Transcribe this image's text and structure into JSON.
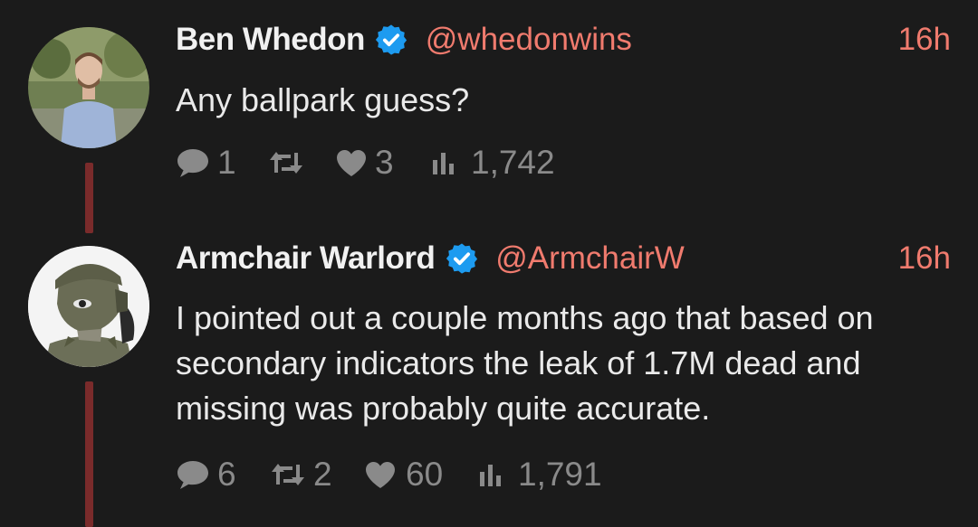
{
  "tweets": [
    {
      "name": "Ben Whedon",
      "handle": "@whedonwins",
      "time": "16h",
      "text": "Any ballpark guess?",
      "replies": "1",
      "retweets": "",
      "likes": "3",
      "views": "1,742",
      "avatar": "man-in-light-blue-shirt"
    },
    {
      "name": "Armchair Warlord",
      "handle": "@ArmchairW",
      "time": "16h",
      "text": "I pointed out a couple months ago that based on secondary indicators the leak of 1.7M dead and missing was probably quite accurate.",
      "replies": "6",
      "retweets": "2",
      "likes": "60",
      "views": "1,791",
      "avatar": "cartoon-soldier-with-helmet"
    }
  ],
  "colors": {
    "background": "#1b1b1b",
    "accent": "#f07b6e",
    "verified": "#1d9bf0",
    "thread": "#7a2b2b",
    "muted": "#8a8a8a"
  }
}
